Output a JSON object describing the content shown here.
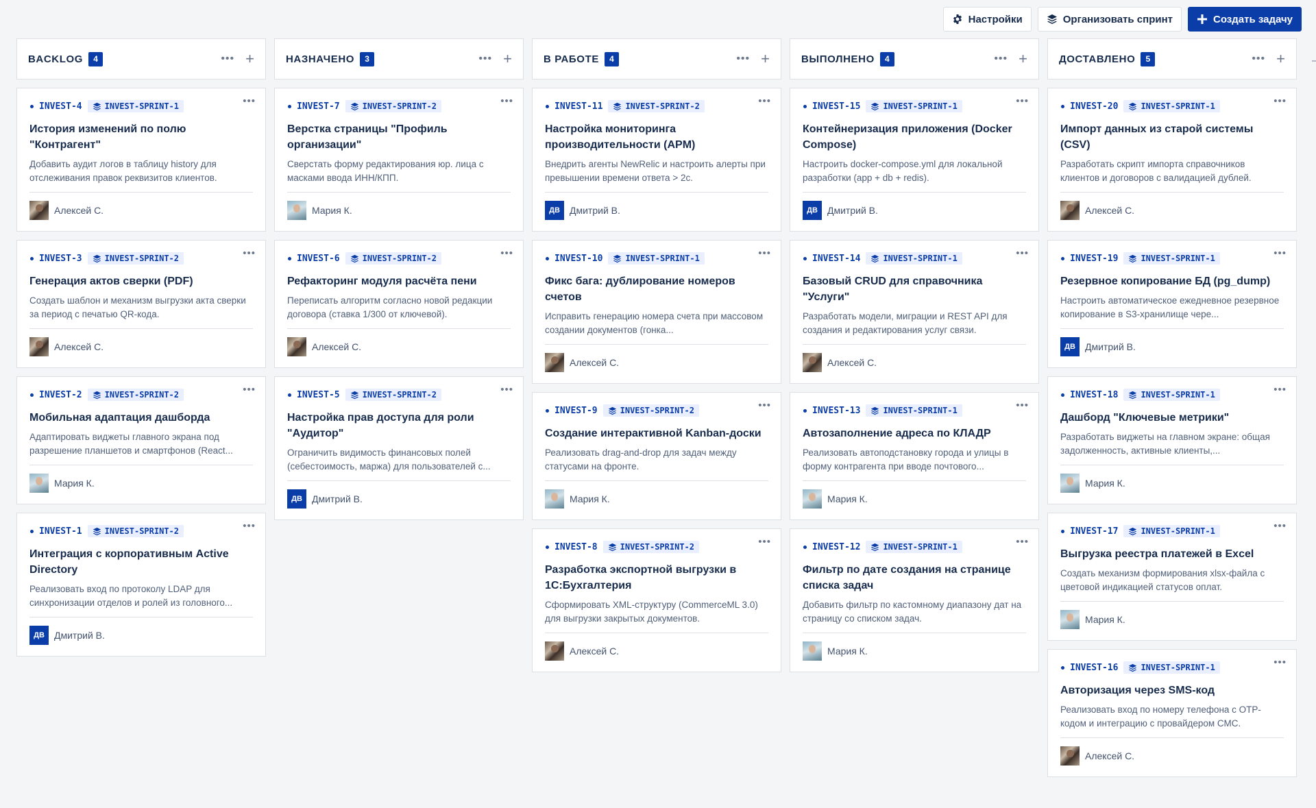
{
  "toolbar": {
    "settings_label": "Настройки",
    "organize_label": "Организовать спринт",
    "create_label": "Создать задачу"
  },
  "columns": [
    {
      "title": "BACKLOG",
      "count": "4",
      "cards": [
        {
          "key": "INVEST-4",
          "sprint": "INVEST-SPRINT-1",
          "title": "История изменений по полю \"Контрагент\"",
          "desc": "Добавить аудит логов в таблицу history для отслеживания правок реквизитов клиентов.",
          "assignee": "Алексей С.",
          "avatar": "photo-a",
          "initials": ""
        },
        {
          "key": "INVEST-3",
          "sprint": "INVEST-SPRINT-2",
          "title": "Генерация актов сверки (PDF)",
          "desc": "Создать шаблон и механизм выгрузки акта сверки за период с печатью QR-кода.",
          "assignee": "Алексей С.",
          "avatar": "photo-a",
          "initials": ""
        },
        {
          "key": "INVEST-2",
          "sprint": "INVEST-SPRINT-2",
          "title": "Мобильная адаптация дашборда",
          "desc": "Адаптировать виджеты главного экрана под разрешение планшетов и смартфонов (React...",
          "assignee": "Мария К.",
          "avatar": "photo-m",
          "initials": ""
        },
        {
          "key": "INVEST-1",
          "sprint": "INVEST-SPRINT-2",
          "title": "Интеграция с корпоративным Active Directory",
          "desc": "Реализовать вход по протоколу LDAP для синхронизации отделов и ролей из головного...",
          "assignee": "Дмитрий В.",
          "avatar": "initials",
          "initials": "ДВ"
        }
      ]
    },
    {
      "title": "НАЗНАЧЕНО",
      "count": "3",
      "cards": [
        {
          "key": "INVEST-7",
          "sprint": "INVEST-SPRINT-2",
          "title": "Верстка страницы \"Профиль организации\"",
          "desc": "Сверстать форму редактирования юр. лица с масками ввода ИНН/КПП.",
          "assignee": "Мария К.",
          "avatar": "photo-m",
          "initials": ""
        },
        {
          "key": "INVEST-6",
          "sprint": "INVEST-SPRINT-2",
          "title": "Рефакторинг модуля расчёта пени",
          "desc": "Переписать алгоритм согласно новой редакции договора (ставка 1/300 от ключевой).",
          "assignee": "Алексей С.",
          "avatar": "photo-a",
          "initials": ""
        },
        {
          "key": "INVEST-5",
          "sprint": "INVEST-SPRINT-2",
          "title": "Настройка прав доступа для роли \"Аудитор\"",
          "desc": "Ограничить видимость финансовых полей (себестоимость, маржа) для пользователей с...",
          "assignee": "Дмитрий В.",
          "avatar": "initials",
          "initials": "ДВ"
        }
      ]
    },
    {
      "title": "В РАБОТЕ",
      "count": "4",
      "cards": [
        {
          "key": "INVEST-11",
          "sprint": "INVEST-SPRINT-2",
          "title": "Настройка мониторинга производительности (APM)",
          "desc": "Внедрить агенты NewRelic и настроить алерты при превышении времени ответа > 2с.",
          "assignee": "Дмитрий В.",
          "avatar": "initials",
          "initials": "ДВ"
        },
        {
          "key": "INVEST-10",
          "sprint": "INVEST-SPRINT-1",
          "title": "Фикс бага: дублирование номеров счетов",
          "desc": "Исправить генерацию номера счета при массовом создании документов (гонка...",
          "assignee": "Алексей С.",
          "avatar": "photo-a",
          "initials": ""
        },
        {
          "key": "INVEST-9",
          "sprint": "INVEST-SPRINT-2",
          "title": "Создание интерактивной Kanban-доски",
          "desc": "Реализовать drag-and-drop для задач между статусами на фронте.",
          "assignee": "Мария К.",
          "avatar": "photo-m",
          "initials": ""
        },
        {
          "key": "INVEST-8",
          "sprint": "INVEST-SPRINT-2",
          "title": "Разработка экспортной выгрузки в 1С:Бухгалтерия",
          "desc": "Сформировать XML-структуру (CommerceML 3.0) для выгрузки закрытых документов.",
          "assignee": "Алексей С.",
          "avatar": "photo-a",
          "initials": ""
        }
      ]
    },
    {
      "title": "ВЫПОЛНЕНО",
      "count": "4",
      "cards": [
        {
          "key": "INVEST-15",
          "sprint": "INVEST-SPRINT-1",
          "title": "Контейнеризация приложения (Docker Compose)",
          "desc": "Настроить docker-compose.yml для локальной разработки (app + db + redis).",
          "assignee": "Дмитрий В.",
          "avatar": "initials",
          "initials": "ДВ"
        },
        {
          "key": "INVEST-14",
          "sprint": "INVEST-SPRINT-1",
          "title": "Базовый CRUD для справочника \"Услуги\"",
          "desc": "Разработать модели, миграции и REST API для создания и редактирования услуг связи.",
          "assignee": "Алексей С.",
          "avatar": "photo-a",
          "initials": ""
        },
        {
          "key": "INVEST-13",
          "sprint": "INVEST-SPRINT-1",
          "title": "Автозаполнение адреса по КЛАДР",
          "desc": "Реализовать автоподстановку города и улицы в форму контрагента при вводе почтового...",
          "assignee": "Мария К.",
          "avatar": "photo-m",
          "initials": ""
        },
        {
          "key": "INVEST-12",
          "sprint": "INVEST-SPRINT-1",
          "title": "Фильтр по дате создания на странице списка задач",
          "desc": "Добавить фильтр по кастомному диапазону дат на страницу со списком задач.",
          "assignee": "Мария К.",
          "avatar": "photo-m",
          "initials": ""
        }
      ]
    },
    {
      "title": "ДОСТАВЛЕНО",
      "count": "5",
      "cards": [
        {
          "key": "INVEST-20",
          "sprint": "INVEST-SPRINT-1",
          "title": "Импорт данных из старой системы (CSV)",
          "desc": "Разработать скрипт импорта справочников клиентов и договоров с валидацией дублей.",
          "assignee": "Алексей С.",
          "avatar": "photo-a",
          "initials": ""
        },
        {
          "key": "INVEST-19",
          "sprint": "INVEST-SPRINT-1",
          "title": "Резервное копирование БД (pg_dump)",
          "desc": "Настроить автоматическое ежедневное резервное копирование в S3-хранилище чере...",
          "assignee": "Дмитрий В.",
          "avatar": "initials",
          "initials": "ДВ"
        },
        {
          "key": "INVEST-18",
          "sprint": "INVEST-SPRINT-1",
          "title": "Дашборд \"Ключевые метрики\"",
          "desc": "Разработать виджеты на главном экране: общая задолженность, активные клиенты,...",
          "assignee": "Мария К.",
          "avatar": "photo-m",
          "initials": ""
        },
        {
          "key": "INVEST-17",
          "sprint": "INVEST-SPRINT-1",
          "title": "Выгрузка реестра платежей в Excel",
          "desc": "Создать механизм формирования xlsx-файла с цветовой индикацией статусов оплат.",
          "assignee": "Мария К.",
          "avatar": "photo-m",
          "initials": ""
        },
        {
          "key": "INVEST-16",
          "sprint": "INVEST-SPRINT-1",
          "title": "Авторизация через SMS-код",
          "desc": "Реализовать вход по номеру телефона с OTP-кодом и интеграцию с провайдером СМС.",
          "assignee": "Алексей С.",
          "avatar": "photo-a",
          "initials": ""
        }
      ]
    }
  ],
  "icons": {
    "settings": "gear-icon",
    "organize": "layers-icon",
    "create": "plus-icon",
    "sprint": "layers-icon",
    "column_menu": "more-horizontal-icon",
    "column_add": "plus-icon"
  },
  "colors": {
    "accent": "#0b3da8",
    "sprint_bg": "#e9efff",
    "border": "#dcdfe4"
  }
}
